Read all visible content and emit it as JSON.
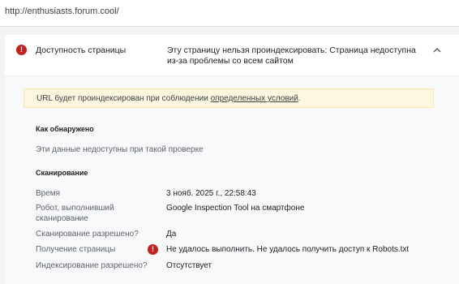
{
  "url": "http://enthusiasts.forum.cool/",
  "card": {
    "title": "Доступность страницы",
    "description": "Эту страницу нельзя проиндексировать: Страница недоступна из-за проблемы со всем сайтом",
    "status_icon": "error-icon",
    "toggle_icon": "chevron-up-icon"
  },
  "notice": {
    "prefix": "URL будет проиндексирован при соблюдении ",
    "link": "определенных условий",
    "suffix": "."
  },
  "discovery": {
    "heading": "Как обнаружено",
    "message": "Эти данные недоступны при такой проверке"
  },
  "crawl": {
    "heading": "Сканирование",
    "rows": [
      {
        "label": "Время",
        "value": "3 нояб. 2025 г., 22:58:43"
      },
      {
        "label": "Робот, выполнивший сканирование",
        "value": "Google Inspection Tool на смартфоне"
      },
      {
        "label": "Сканирование разрешено?",
        "value": "Да"
      },
      {
        "label": "Получение страницы",
        "value": "Не удалось выполнить. Не удалось получить доступ к Robots.txt"
      },
      {
        "label": "Индексирование разрешено?",
        "value": "Отсутствует"
      }
    ]
  },
  "colors": {
    "error": "#c5221f",
    "notice_bg": "#fef7e0"
  }
}
